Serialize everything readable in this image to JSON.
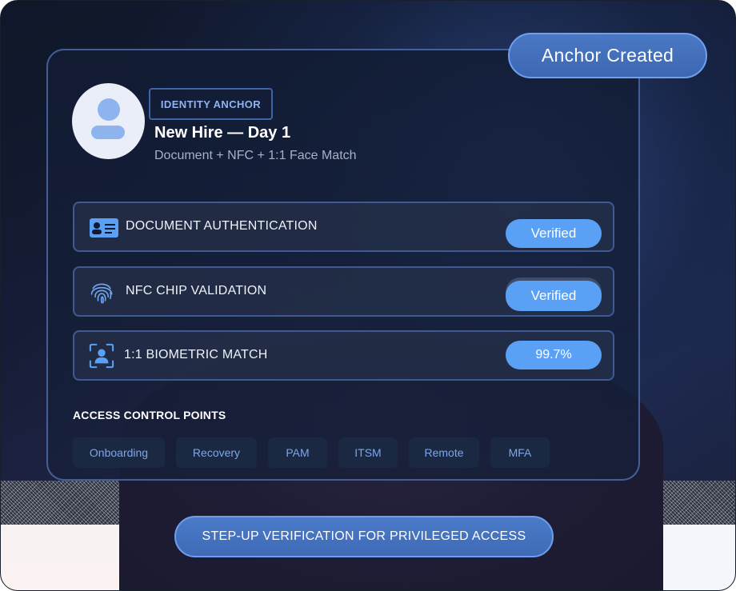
{
  "header": {
    "anchor_button_label": "Anchor Created"
  },
  "profile": {
    "tag": "IDENTITY ANCHOR",
    "title": "New Hire — Day 1",
    "subtitle": "Document + NFC + 1:1 Face Match",
    "avatar_icon": "user-icon"
  },
  "checks": [
    {
      "label": "DOCUMENT AUTHENTICATION",
      "status": "Verified",
      "icon": "id-card-icon"
    },
    {
      "label": "NFC CHIP VALIDATION",
      "status": "Verified",
      "icon": "fingerprint-icon"
    },
    {
      "label": "1:1 BIOMETRIC MATCH",
      "status": "99.7%",
      "icon": "face-scan-icon"
    }
  ],
  "access_control": {
    "title": "ACCESS CONTROL POINTS",
    "points": [
      "Onboarding",
      "Recovery",
      "PAM",
      "ITSM",
      "Remote",
      "MFA"
    ]
  },
  "footer": {
    "stepup_label": "STEP-UP VERIFICATION FOR PRIVILEGED ACCESS"
  },
  "colors": {
    "accent": "#5aa0f5",
    "background": "#131b33",
    "tag_text": "#8fb3f2"
  }
}
